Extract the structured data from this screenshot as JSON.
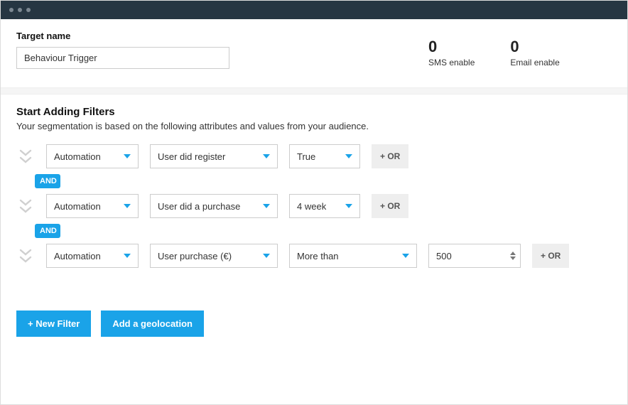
{
  "header": {
    "target_name_label": "Target name",
    "target_name_value": "Behaviour Trigger"
  },
  "stats": {
    "sms": {
      "value": "0",
      "label": "SMS enable"
    },
    "email": {
      "value": "0",
      "label": "Email enable"
    }
  },
  "filters": {
    "title": "Start Adding Filters",
    "subtitle": "Your segmentation is based on the following attributes and values from your audience.",
    "and_label": "AND",
    "or_label": "+ OR",
    "rules": [
      {
        "category": "Automation",
        "attribute": "User did register",
        "value": "True"
      },
      {
        "category": "Automation",
        "attribute": "User did a purchase",
        "value": "4 week"
      },
      {
        "category": "Automation",
        "attribute": "User purchase (€)",
        "operator": "More than",
        "number": "500"
      }
    ]
  },
  "actions": {
    "new_filter": "+ New Filter",
    "add_geo": "Add a geolocation"
  }
}
